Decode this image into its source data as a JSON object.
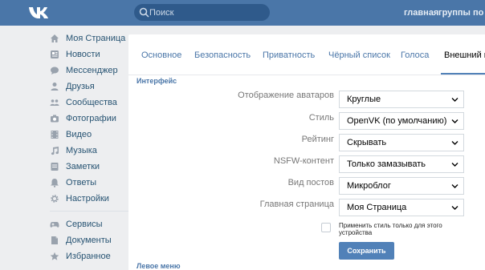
{
  "header": {
    "search_placeholder": "Поиск",
    "nav": [
      "главная",
      "группы",
      "по"
    ]
  },
  "sidebar": {
    "items": [
      {
        "label": "Моя Страница",
        "icon": "home-icon"
      },
      {
        "label": "Новости",
        "icon": "news-icon"
      },
      {
        "label": "Мессенджер",
        "icon": "messenger-icon"
      },
      {
        "label": "Друзья",
        "icon": "friend-icon"
      },
      {
        "label": "Сообщества",
        "icon": "groups-icon"
      },
      {
        "label": "Фотографии",
        "icon": "camera-icon"
      },
      {
        "label": "Видео",
        "icon": "video-icon"
      },
      {
        "label": "Музыка",
        "icon": "music-icon"
      },
      {
        "label": "Заметки",
        "icon": "notes-icon"
      },
      {
        "label": "Ответы",
        "icon": "bell-icon"
      },
      {
        "label": "Настройки",
        "icon": "gear-icon"
      }
    ],
    "extra": [
      {
        "label": "Сервисы",
        "icon": "gamepad-icon"
      },
      {
        "label": "Документы",
        "icon": "document-icon"
      },
      {
        "label": "Избранное",
        "icon": "star-icon"
      }
    ]
  },
  "tabs": [
    {
      "label": "Основное",
      "active": false
    },
    {
      "label": "Безопасность",
      "active": false
    },
    {
      "label": "Приватность",
      "active": false
    },
    {
      "label": "Чёрный список",
      "active": false
    },
    {
      "label": "Голоса",
      "active": false
    },
    {
      "label": "Внешний ви",
      "active": true
    }
  ],
  "interface_section": {
    "title": "Интерфейс",
    "fields": [
      {
        "label": "Отображение аватаров",
        "value": "Круглые"
      },
      {
        "label": "Стиль",
        "value": "OpenVK (по умолчанию)"
      },
      {
        "label": "Рейтинг",
        "value": "Скрывать"
      },
      {
        "label": "NSFW-контент",
        "value": "Только замазывать"
      },
      {
        "label": "Вид постов",
        "value": "Микроблог"
      },
      {
        "label": "Главная страница",
        "value": "Моя Страница"
      }
    ],
    "checkbox_label": "Применить стиль только для этого устройства",
    "checkbox_checked": false,
    "save_label": "Сохранить"
  },
  "left_menu_section": {
    "title": "Левое меню"
  },
  "colors": {
    "header": "#4a76a8",
    "accent": "#5181b8",
    "link": "#285473",
    "icon": "#99a2ad"
  }
}
